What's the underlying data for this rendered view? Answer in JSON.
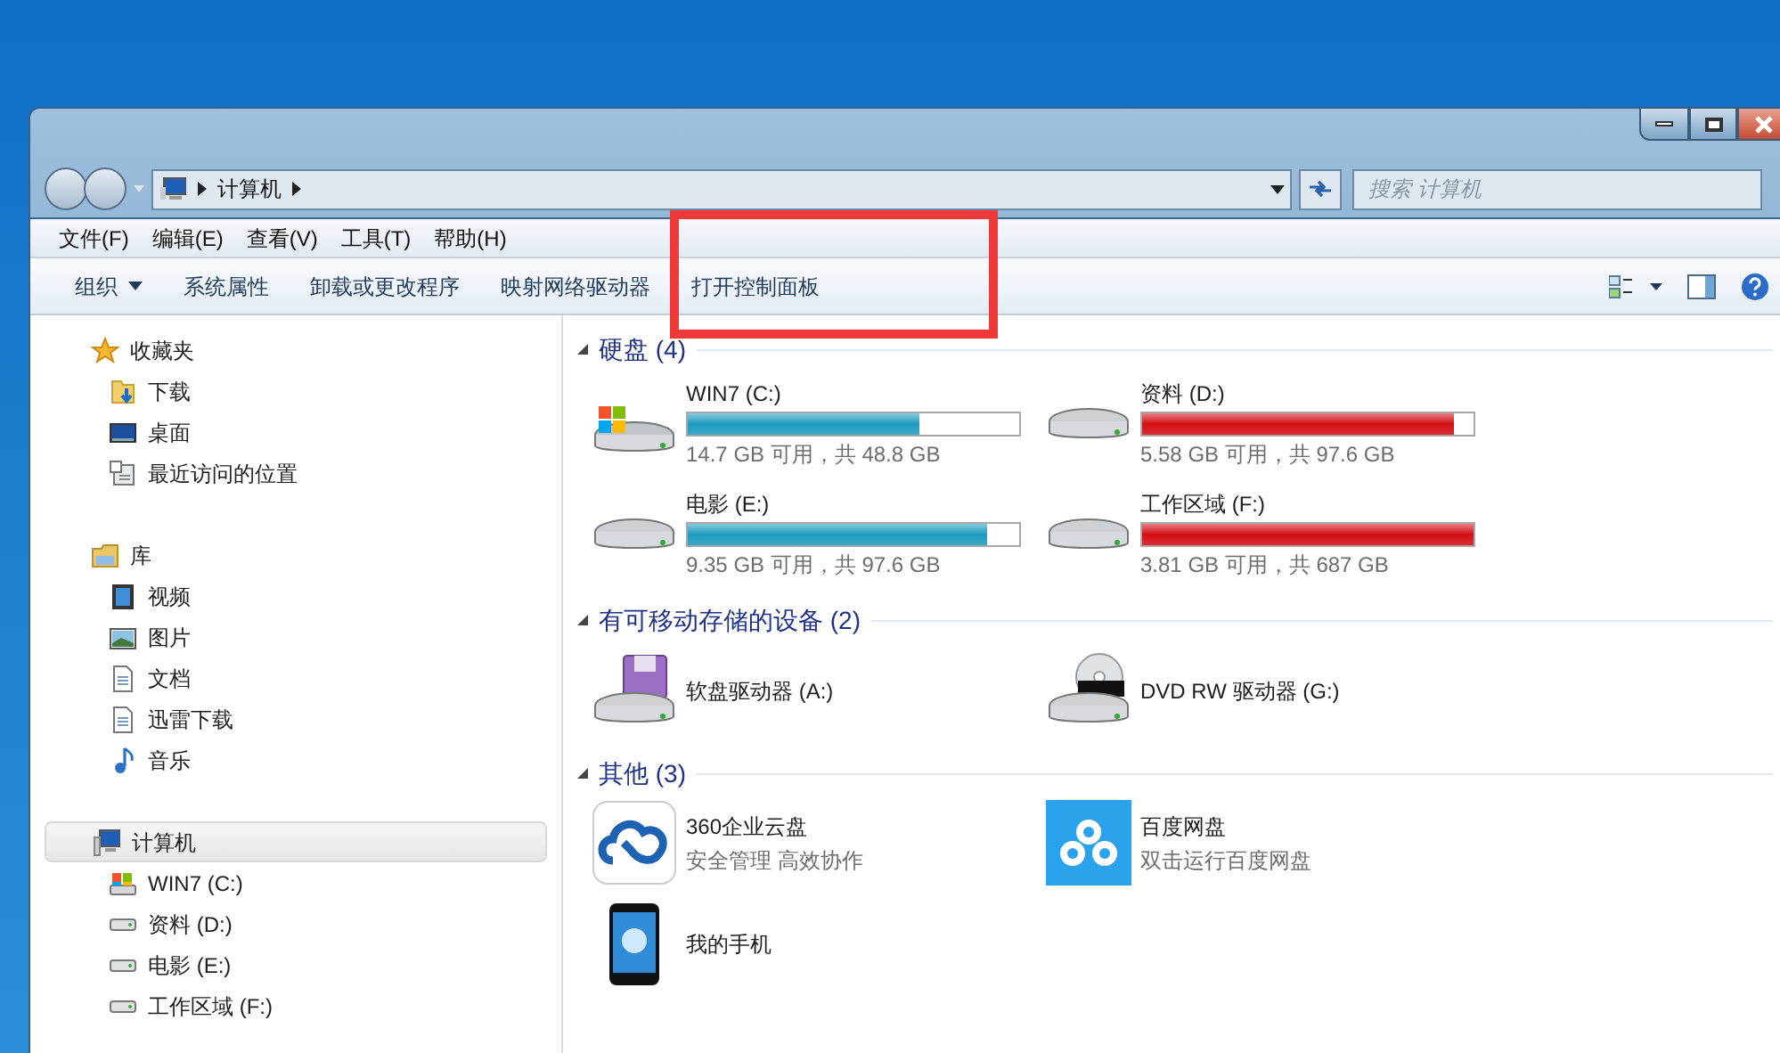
{
  "window": {
    "address": {
      "path": [
        "计算机"
      ]
    },
    "search": {
      "placeholder": "搜索 计算机"
    }
  },
  "menu": [
    "文件(F)",
    "编辑(E)",
    "查看(V)",
    "工具(T)",
    "帮助(H)"
  ],
  "toolbar": [
    {
      "label": "组织",
      "dropdown": true
    },
    {
      "label": "系统属性",
      "dropdown": false
    },
    {
      "label": "卸载或更改程序",
      "dropdown": false
    },
    {
      "label": "映射网络驱动器",
      "dropdown": false
    },
    {
      "label": "打开控制面板",
      "dropdown": false
    }
  ],
  "sidebar": [
    {
      "label": "收藏夹",
      "kind": "star",
      "selected": false,
      "children": [
        {
          "label": "下载",
          "kind": "download"
        },
        {
          "label": "桌面",
          "kind": "desktop"
        },
        {
          "label": "最近访问的位置",
          "kind": "recent"
        }
      ]
    },
    {
      "label": "库",
      "kind": "library",
      "selected": false,
      "children": [
        {
          "label": "视频",
          "kind": "video"
        },
        {
          "label": "图片",
          "kind": "picture"
        },
        {
          "label": "文档",
          "kind": "document"
        },
        {
          "label": "迅雷下载",
          "kind": "document"
        },
        {
          "label": "音乐",
          "kind": "music"
        }
      ]
    },
    {
      "label": "计算机",
      "kind": "computer",
      "selected": true,
      "children": [
        {
          "label": "WIN7 (C:)",
          "kind": "windrive"
        },
        {
          "label": "资料 (D:)",
          "kind": "drive"
        },
        {
          "label": "电影 (E:)",
          "kind": "drive"
        },
        {
          "label": "工作区域 (F:)",
          "kind": "drive"
        }
      ]
    }
  ],
  "groups": [
    {
      "title": "硬盘 (4)",
      "items": [
        {
          "kind": "system_disk",
          "name": "WIN7 (C:)",
          "level": 0.7,
          "color": "#1e9bbf",
          "detail": "14.7 GB 可用，共 48.8 GB"
        },
        {
          "kind": "disk",
          "name": "资料 (D:)",
          "level": 0.94,
          "color": "#d40f14",
          "detail": "5.58 GB 可用，共 97.6 GB"
        },
        {
          "kind": "disk",
          "name": "电影 (E:)",
          "level": 0.905,
          "color": "#1e9bbf",
          "detail": "9.35 GB 可用，共 97.6 GB"
        },
        {
          "kind": "disk",
          "name": "工作区域 (F:)",
          "level": 1,
          "color": "#d40f14",
          "detail": "3.81 GB 可用，共 687 GB"
        }
      ]
    },
    {
      "title": "有可移动存储的设备 (2)",
      "items": [
        {
          "kind": "floppy",
          "name": "软盘驱动器 (A:)"
        },
        {
          "kind": "dvd",
          "name": "DVD RW 驱动器 (G:)"
        }
      ]
    },
    {
      "title": "其他 (3)",
      "items": [
        {
          "kind": "cloud_app_360",
          "name": "360企业云盘",
          "detail": "安全管理 高效协作"
        },
        {
          "kind": "cloud_app_baidu",
          "name": "百度网盘",
          "detail": "双击运行百度网盘"
        },
        {
          "kind": "phone",
          "name": "我的手机"
        }
      ]
    }
  ]
}
